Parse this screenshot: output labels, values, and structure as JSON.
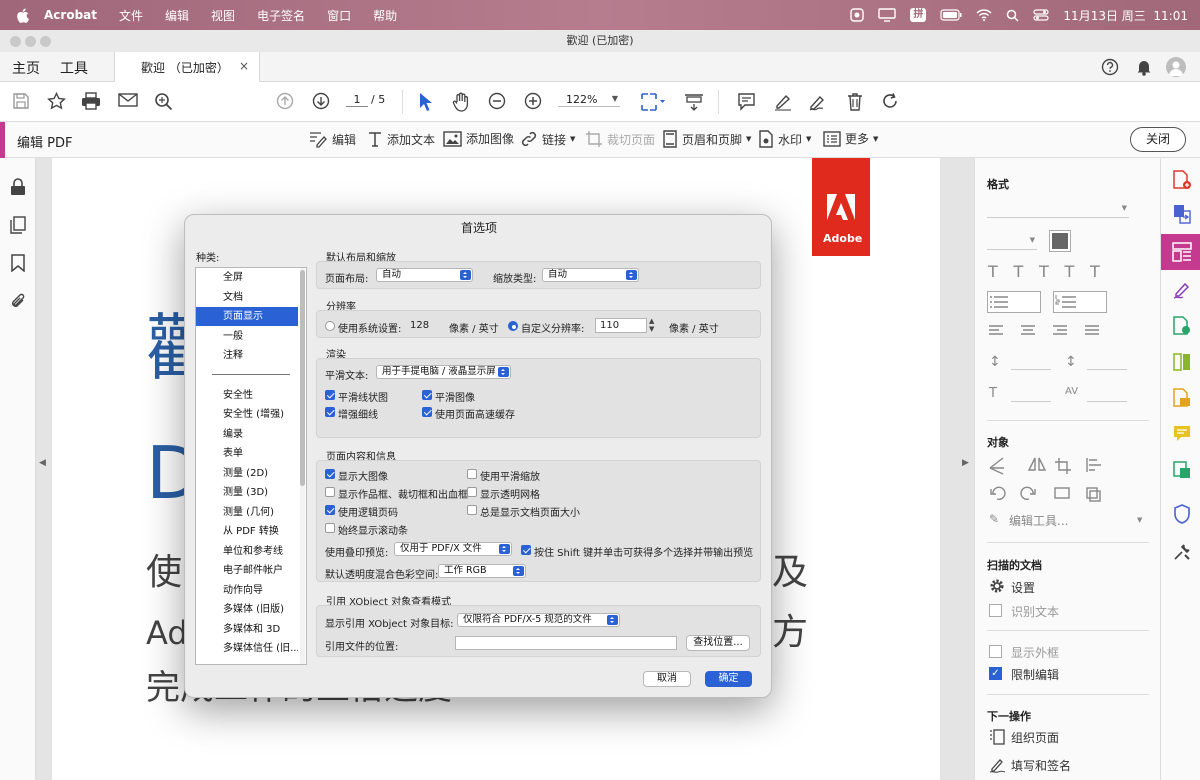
{
  "menubar": {
    "app": "Acrobat",
    "items": [
      "文件",
      "编辑",
      "视图",
      "电子签名",
      "窗口",
      "帮助"
    ],
    "ime": "拼",
    "clock": "11月13日 周三  11:01"
  },
  "window": {
    "title": "歡迎 (已加密)"
  },
  "tabs": {
    "home": "主页",
    "tools": "工具",
    "doc": "歡迎 （已加密）",
    "close": "×"
  },
  "toolbar": {
    "page_current": "1",
    "page_total": "/ 5",
    "zoom": "122%"
  },
  "editbar": {
    "title": "编辑 PDF",
    "tools": [
      "编辑",
      "添加文本",
      "添加图像",
      "链接",
      "裁切页面",
      "页眉和页脚",
      "水印",
      "更多"
    ],
    "close": "关闭"
  },
  "document": {
    "logo_text": "Adobe",
    "line1": "歡",
    "line2": "D",
    "line3_a": "使",
    "line3_b": "及",
    "line4_a": "Ad",
    "line4_b": "方",
    "line5": "完成工作的五倍速度"
  },
  "rightpanel": {
    "format": "格式",
    "objects": "对象",
    "edit_tool": "编辑工具...",
    "scanned": "扫描的文档",
    "settings": "设置",
    "ocr": "识别文本",
    "show_bbox": "显示外框",
    "restrict": "限制编辑",
    "next": "下一操作",
    "organize": "组织页面",
    "fillsign": "填写和签名"
  },
  "dialog": {
    "title": "首选项",
    "cat_label": "种类:",
    "categories": [
      "全屏",
      "文档",
      "页面显示",
      "一般",
      "注释",
      "安全性",
      "安全性 (增强)",
      "编录",
      "表单",
      "测量 (2D)",
      "测量 (3D)",
      "测量 (几何)",
      "从 PDF 转换",
      "单位和参考线",
      "电子邮件帐户",
      "动作向导",
      "多媒体 (旧版)",
      "多媒体和 3D",
      "多媒体信任 (旧..."
    ],
    "g1": {
      "title": "默认布局和缩放",
      "layout_label": "页面布局:",
      "layout_value": "自动",
      "zoom_label": "缩放类型:",
      "zoom_value": "自动"
    },
    "g2": {
      "title": "分辨率",
      "sys_label": "使用系统设置:",
      "sys_value": "128",
      "unit1": "像素 / 英寸",
      "custom_label": "自定义分辨率:",
      "custom_value": "110",
      "unit2": "像素 / 英寸"
    },
    "g3": {
      "title": "渲染",
      "smooth_label": "平滑文本:",
      "smooth_value": "用于手提电脑 / 液晶显示屏",
      "c1": "平滑线状图",
      "c2": "平滑图像",
      "c3": "增强细线",
      "c4": "使用页面高速缓存"
    },
    "g4": {
      "title": "页面内容和信息",
      "c1": "显示大图像",
      "c2": "使用平滑缩放",
      "c3": "显示作品框、裁切框和出血框",
      "c4": "显示透明网格",
      "c5": "使用逻辑页码",
      "c6": "总是显示文档页面大小",
      "c7": "始终显示滚动条",
      "overprint_label": "使用叠印预览:",
      "overprint_value": "仅用于 PDF/X 文件",
      "shift_label": "按住 Shift 键并单击可获得多个选择并带输出预览",
      "blend_label": "默认透明度混合色彩空间:",
      "blend_value": "工作 RGB"
    },
    "g5": {
      "title": "引用 XObject 对象查看模式",
      "target_label": "显示引用 XObject 对象目标:",
      "target_value": "仅限符合 PDF/X-5 规范的文件",
      "loc_label": "引用文件的位置:",
      "browse": "查找位置..."
    },
    "cancel": "取消",
    "ok": "确定"
  }
}
